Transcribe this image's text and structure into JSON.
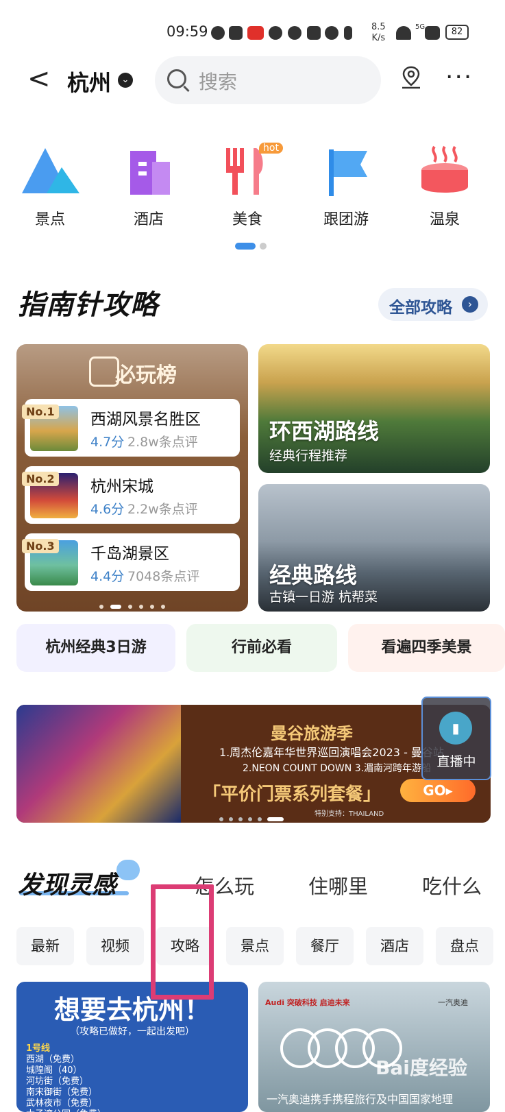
{
  "status_bar": {
    "time": "09:59",
    "speed_value": "8.5",
    "speed_unit": "K/s",
    "signal": "5G",
    "battery": "82"
  },
  "header": {
    "back_glyph": "<",
    "city": "杭州",
    "search_placeholder": "搜索",
    "more_glyph": "···"
  },
  "categories": [
    {
      "label": "景点",
      "icon": "mountain-icon",
      "color": "#3d8fe8"
    },
    {
      "label": "酒店",
      "icon": "building-icon",
      "color": "#9d5be6"
    },
    {
      "label": "美食",
      "icon": "fork-knife-icon",
      "color": "#f2505a",
      "badge": "hot"
    },
    {
      "label": "跟团游",
      "icon": "flag-icon",
      "color": "#3a8fea"
    },
    {
      "label": "温泉",
      "icon": "hot-spring-icon",
      "color": "#f3575e"
    }
  ],
  "guide": {
    "title": "指南针攻略",
    "all_button": "全部攻略",
    "must_play": {
      "title": "必玩榜",
      "items": [
        {
          "rank": "No.1",
          "name": "西湖风景名胜区",
          "score": "4.7分",
          "reviews": "2.8w条点评"
        },
        {
          "rank": "No.2",
          "name": "杭州宋城",
          "score": "4.6分",
          "reviews": "2.2w条点评"
        },
        {
          "rank": "No.3",
          "name": "千岛湖景区",
          "score": "4.4分",
          "reviews": "7048条点评"
        }
      ]
    },
    "route_cards": [
      {
        "title": "环西湖路线",
        "subtitle": "经典行程推荐"
      },
      {
        "title": "经典路线",
        "subtitle": "古镇一日游 杭帮菜"
      }
    ],
    "pills": [
      "杭州经典3日游",
      "行前必看",
      "看遍四季美景"
    ]
  },
  "banner": {
    "title": "曼谷旅游季",
    "line1": "1.周杰伦嘉年华世界巡回演唱会2023 - 曼谷站",
    "line2": "2.NEON COUNT DOWN   3.湄南河跨年游船",
    "slogan": "「平价门票系列套餐」",
    "go": "GO▸",
    "sponsor": "特别支持：THAILAND",
    "live": "直播中"
  },
  "discover": {
    "title": "发现灵感",
    "tabs": [
      "怎么玩",
      "住哪里",
      "吃什么"
    ],
    "filters": [
      "最新",
      "视频",
      "攻略",
      "景点",
      "餐厅",
      "酒店",
      "盘点"
    ]
  },
  "feed": [
    {
      "title": "想要去杭州！",
      "subtitle": "（攻略已做好，一起出发吧）",
      "lines": [
        "1号线",
        "西湖（免费）",
        "城隍阁（40）",
        "河坊街（免费）",
        "南宋御街（免费）",
        "武林夜市（免费）",
        "太子湾公园（免费）"
      ]
    },
    {
      "brand_left": "Audi 突破科技 启迪未来",
      "brand_right": "一汽奥迪",
      "caption": "一汽奥迪携手携程旅行及中国国家地理"
    }
  ],
  "watermark": "Bai度经验"
}
